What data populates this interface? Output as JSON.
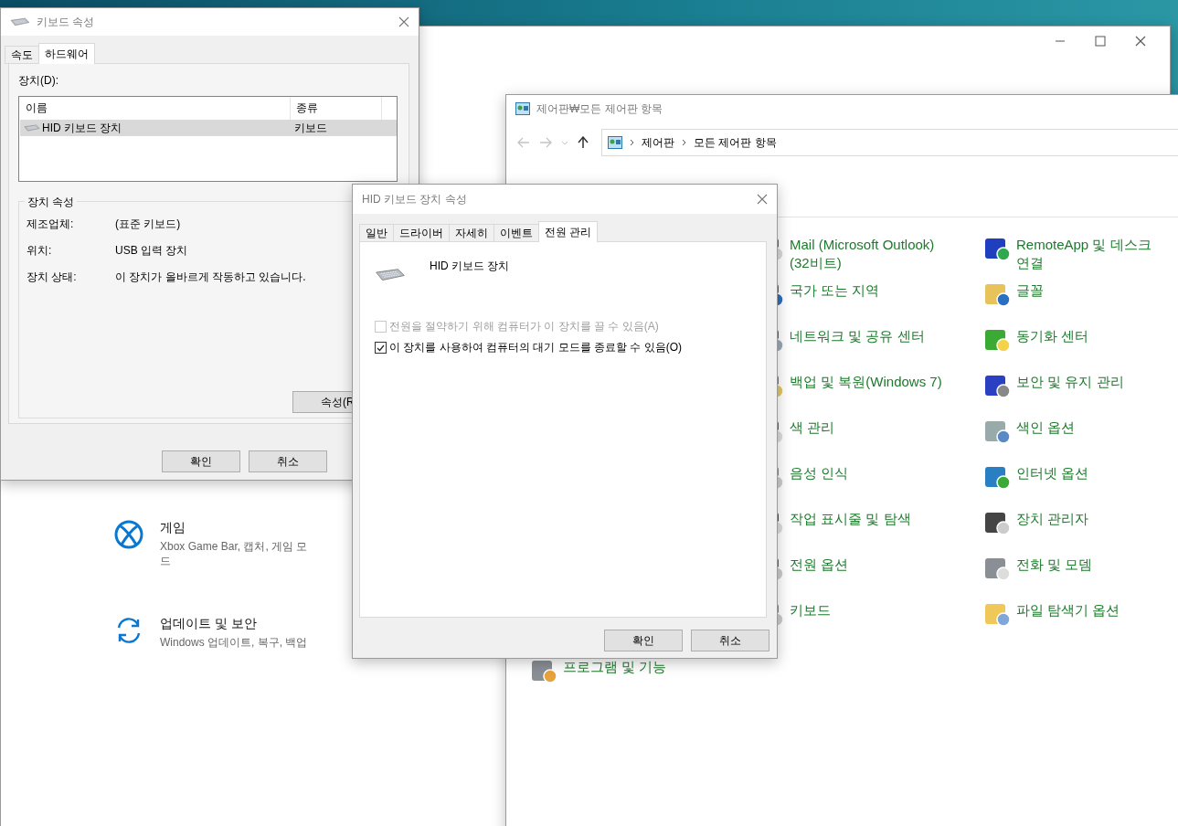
{
  "settings_window": {
    "items": [
      {
        "kind": "game",
        "title": "게임",
        "subtitle": "Xbox Game Bar, 캡처, 게임 모드"
      },
      {
        "kind": "update",
        "title": "업데이트 및 보안",
        "subtitle": "Windows 업데이트, 복구, 백업"
      }
    ]
  },
  "keyboard_dialog": {
    "title": "키보드 속성",
    "tabs": [
      {
        "label": "속도",
        "selected": false
      },
      {
        "label": "하드웨어",
        "selected": true
      }
    ],
    "devices_label": "장치(D):",
    "columns": [
      "이름",
      "종류"
    ],
    "rows": [
      {
        "name": "HID 키보드 장치",
        "type": "키보드",
        "selected": true
      }
    ],
    "group_title": "장치 속성",
    "properties": [
      {
        "label": "제조업체:",
        "value": "(표준 키보드)"
      },
      {
        "label": "위치:",
        "value": "USB 입력 장치"
      },
      {
        "label": "장치 상태:",
        "value": "이 장치가 올바르게 작동하고 있습니다."
      }
    ],
    "properties_button": "속성(R",
    "buttons": [
      "확인",
      "취소"
    ]
  },
  "control_panel": {
    "title": "제어판₩모든 제어판 항목",
    "breadcrumb": [
      "제어판",
      "모든 제어판 항목"
    ],
    "columns": [
      {
        "items": [
          {
            "kind": "programs",
            "label": "프로그램 및 기능"
          }
        ]
      },
      {
        "items": [
          {
            "kind": "mail",
            "label": "Mail (Microsoft Outlook)(32비트)"
          },
          {
            "kind": "globe",
            "label": "국가 또는 지역"
          },
          {
            "kind": "network",
            "label": "네트워크 및 공유 센터"
          },
          {
            "kind": "backup",
            "label": "백업 및 복원(Windows 7)"
          },
          {
            "kind": "color",
            "label": "색 관리"
          },
          {
            "kind": "mic",
            "label": "음성 인식"
          },
          {
            "kind": "taskbar",
            "label": "작업 표시줄 및 탐색"
          },
          {
            "kind": "power",
            "label": "전원 옵션"
          },
          {
            "kind": "keyboard",
            "label": "키보드"
          }
        ]
      },
      {
        "items": [
          {
            "kind": "remote",
            "label": "RemoteApp 및 데스크\n연결"
          },
          {
            "kind": "font",
            "label": "글꼴"
          },
          {
            "kind": "sync",
            "label": "동기화 센터"
          },
          {
            "kind": "flag",
            "label": "보안 및 유지 관리"
          },
          {
            "kind": "index",
            "label": "색인 옵션"
          },
          {
            "kind": "internet",
            "label": "인터넷 옵션"
          },
          {
            "kind": "device",
            "label": "장치 관리자"
          },
          {
            "kind": "phone",
            "label": "전화 및 모뎀"
          },
          {
            "kind": "folder",
            "label": "파일 탐색기 옵션"
          }
        ]
      }
    ]
  },
  "hid_dialog": {
    "title": "HID 키보드 장치 속성",
    "tabs": [
      {
        "label": "일반",
        "selected": false
      },
      {
        "label": "드라이버",
        "selected": false
      },
      {
        "label": "자세히",
        "selected": false
      },
      {
        "label": "이벤트",
        "selected": false
      },
      {
        "label": "전원 관리",
        "selected": true
      }
    ],
    "device_name": "HID 키보드 장치",
    "options": [
      {
        "label": "전원을 절약하기 위해 컴퓨터가 이 장치를 끌 수 있음(A)",
        "checked": false,
        "disabled": true
      },
      {
        "label": "이 장치를 사용하여 컴퓨터의 대기 모드를 종료할 수 있음(O)",
        "checked": true,
        "disabled": false
      }
    ],
    "buttons": [
      "확인",
      "취소"
    ]
  }
}
